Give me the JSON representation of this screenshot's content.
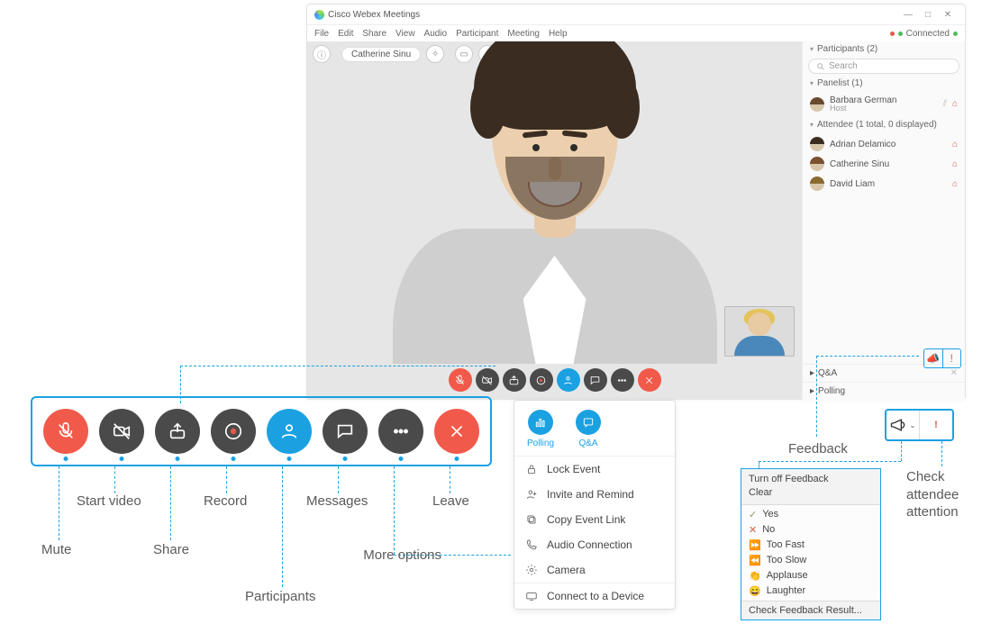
{
  "app_title": "Cisco Webex Meetings",
  "menu": [
    "File",
    "Edit",
    "Share",
    "View",
    "Audio",
    "Participant",
    "Meeting",
    "Help"
  ],
  "connection_label": "Connected",
  "presenter_name": "Catherine Sinu",
  "participants": {
    "title": "Participants (2)",
    "search_placeholder": "Search",
    "panelist_header": "Panelist (1)",
    "attendee_header": "Attendee (1 total, 0 displayed)",
    "panelist": {
      "name": "Barbara German",
      "role": "Host"
    },
    "attendees": [
      {
        "name": "Adrian Delamico"
      },
      {
        "name": "Catherine Sinu"
      },
      {
        "name": "David Liam"
      }
    ]
  },
  "side_sections": {
    "qa": "Q&A",
    "polling": "Polling"
  },
  "toolbar_labels": {
    "mute": "Mute",
    "video": "Start video",
    "share": "Share",
    "record": "Record",
    "participants": "Participants",
    "messages": "Messages",
    "more": "More options",
    "leave": "Leave"
  },
  "more_panel": {
    "polling": "Polling",
    "qa": "Q&A",
    "items": [
      "Lock Event",
      "Invite and Remind",
      "Copy Event Link",
      "Audio Connection",
      "Camera",
      "Connect to a Device"
    ]
  },
  "feedback": {
    "label": "Feedback",
    "turn_off": "Turn off Feedback",
    "clear": "Clear",
    "options": [
      {
        "icon": "✓",
        "color": "#8aa36b",
        "label": "Yes"
      },
      {
        "icon": "✕",
        "color": "#d9604c",
        "label": "No"
      },
      {
        "icon": "⏩",
        "color": "#2f87c4",
        "label": "Too Fast"
      },
      {
        "icon": "⏪",
        "color": "#d26a4b",
        "label": "Too Slow"
      },
      {
        "icon": "👏",
        "color": "#c79b3c",
        "label": "Applause"
      },
      {
        "icon": "😄",
        "color": "#c79b3c",
        "label": "Laughter"
      }
    ],
    "check_results": "Check Feedback Result..."
  },
  "attention_label": "Check\nattendee\nattention"
}
